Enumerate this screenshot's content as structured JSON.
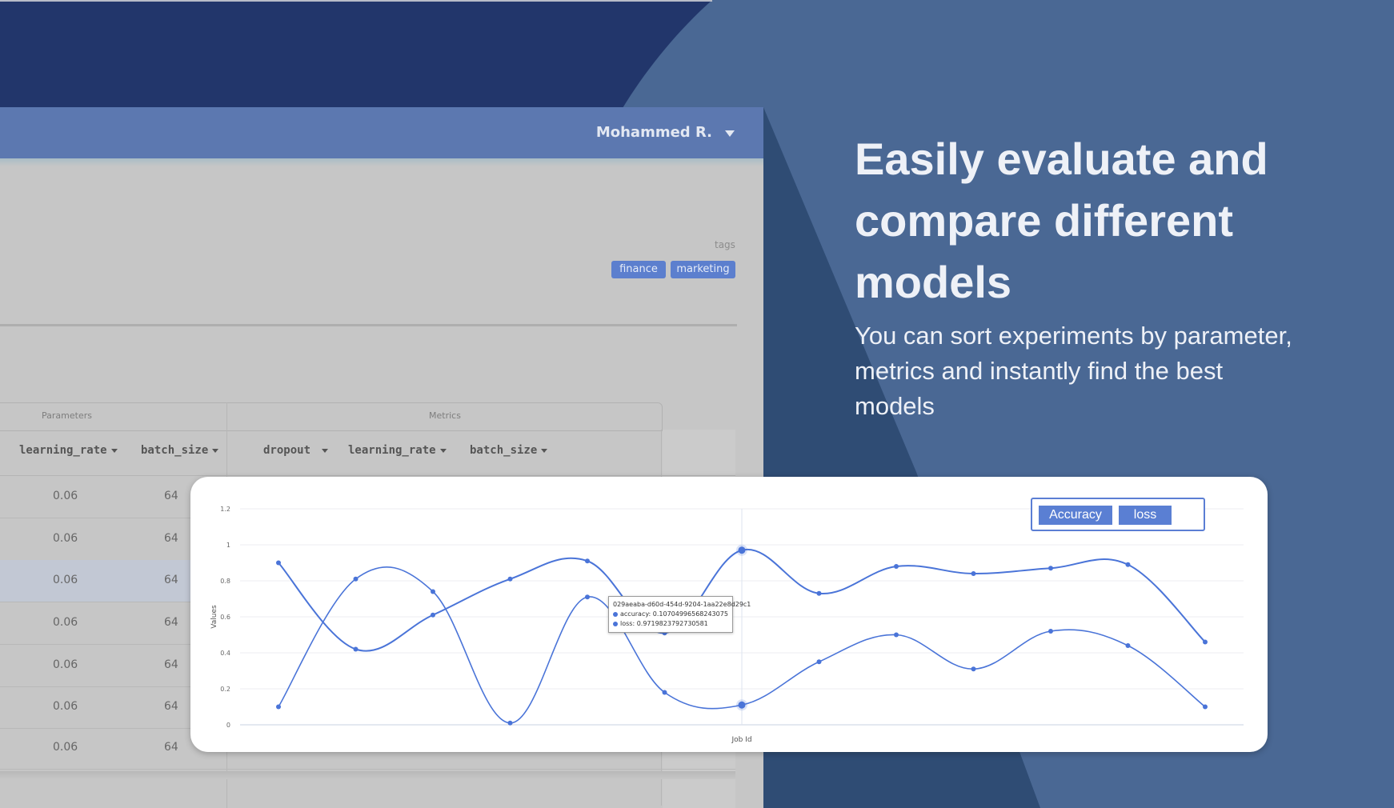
{
  "user": {
    "name": "Mohammed R."
  },
  "tags": {
    "label": "tags",
    "items": [
      "finance",
      "marketing"
    ]
  },
  "table": {
    "groups": {
      "parameters": "Parameters",
      "metrics": "Metrics"
    },
    "columns": {
      "parameters": [
        "learning_rate",
        "batch_size"
      ],
      "metrics": [
        "dropout",
        "learning_rate",
        "batch_size"
      ]
    },
    "rows": [
      {
        "learning_rate": "0.06",
        "batch_size": "64"
      },
      {
        "learning_rate": "0.06",
        "batch_size": "64"
      },
      {
        "learning_rate": "0.06",
        "batch_size": "64"
      },
      {
        "learning_rate": "0.06",
        "batch_size": "64"
      },
      {
        "learning_rate": "0.06",
        "batch_size": "64"
      },
      {
        "learning_rate": "0.06",
        "batch_size": "64"
      },
      {
        "learning_rate": "0.06",
        "batch_size": "64"
      }
    ]
  },
  "headline": "Easily evaluate and compare different models",
  "subtext": "You can sort experiments by parameter, metrics and instantly find the best models",
  "colors": {
    "dark_navy": "#22366b",
    "mid_blue": "#4a6894",
    "dark_slate": "#2f4c74",
    "header_blue": "#5c78b0",
    "series": "#4a74d8"
  },
  "legend": {
    "accuracy_label": "Accuracy",
    "loss_label": "loss"
  },
  "tooltip": {
    "title": "029aeaba-d60d-454d-9204-1aa22e8d29c1",
    "accuracy": "accuracy: 0.10704996568243075",
    "loss": "loss: 0.9719823792730581"
  },
  "chart_data": {
    "type": "line",
    "xlabel": "Job Id",
    "ylabel": "Values",
    "ylim": [
      0,
      1.2
    ],
    "yticks": [
      "0",
      "0.2",
      "0.4",
      "0.6",
      "0.8",
      "1",
      "1.2"
    ],
    "x": [
      0,
      1,
      2,
      3,
      4,
      5,
      6,
      7,
      8,
      9,
      10,
      11,
      12
    ],
    "series": [
      {
        "name": "accuracy",
        "values": [
          0.1,
          0.81,
          0.74,
          0.01,
          0.71,
          0.18,
          0.11,
          0.35,
          0.5,
          0.31,
          0.52,
          0.44,
          0.1
        ]
      },
      {
        "name": "loss",
        "values": [
          0.9,
          0.42,
          0.61,
          0.81,
          0.91,
          0.51,
          0.97,
          0.73,
          0.88,
          0.84,
          0.87,
          0.89,
          0.46
        ]
      }
    ],
    "grid": true,
    "legend_position": "top-right"
  }
}
